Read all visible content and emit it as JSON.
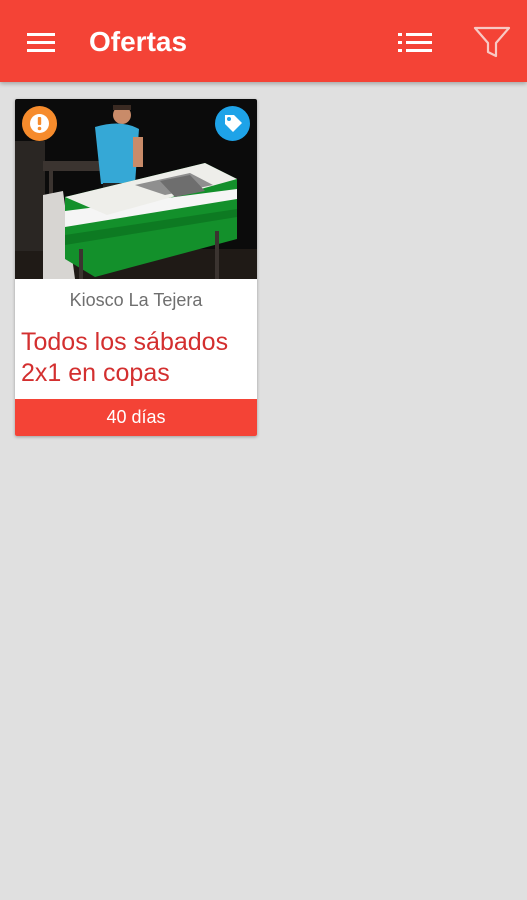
{
  "toolbar": {
    "title": "Ofertas",
    "menu_icon": "menu-icon",
    "list_icon": "list-view-icon",
    "filter_icon": "filter-icon",
    "background_color": "#f44336"
  },
  "offers": [
    {
      "venue": "Kiosco La Tejera",
      "title": "Todos los sábados 2x1 en copas",
      "duration": "40 días",
      "alert_badge_icon": "exclamation-icon",
      "tag_badge_icon": "tag-icon",
      "alert_badge_color": "#f68b2c",
      "tag_badge_color": "#1ea3e8",
      "title_color": "#d32f2f"
    }
  ],
  "colors": {
    "accent": "#f44336",
    "background": "#e0e0e0"
  }
}
